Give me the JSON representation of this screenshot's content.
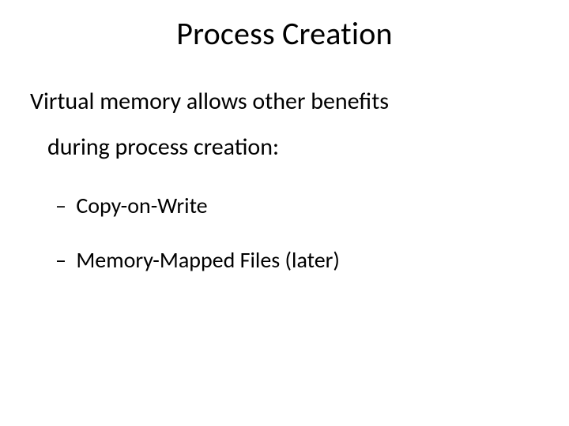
{
  "title": "Process Creation",
  "lead_line1": "Virtual memory allows other benefits",
  "lead_line2": "during process creation:",
  "items": [
    "Copy-on-Write",
    "Memory-Mapped Files (later)"
  ],
  "dash": "–"
}
